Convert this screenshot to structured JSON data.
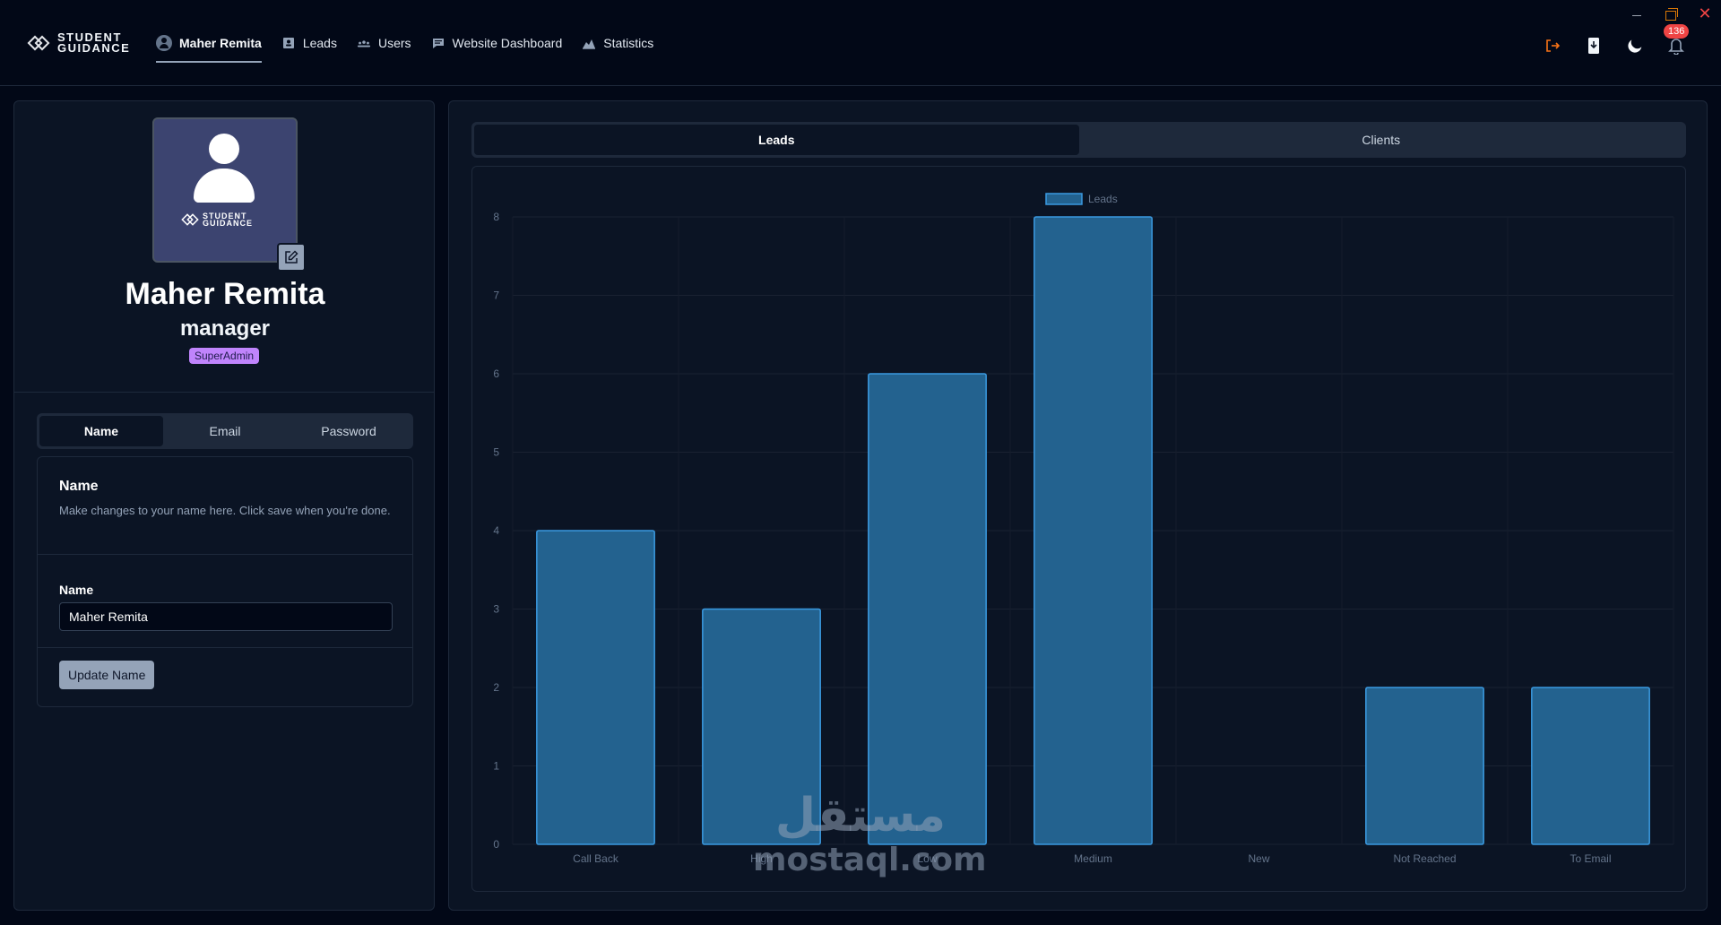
{
  "app": {
    "logo_line1": "STUDENT",
    "logo_line2": "GUIDANCE"
  },
  "nav": [
    {
      "label": "Maher Remita",
      "icon": "user-avatar-icon",
      "active": true
    },
    {
      "label": "Leads",
      "icon": "contact-book-icon",
      "active": false
    },
    {
      "label": "Users",
      "icon": "users-group-icon",
      "active": false
    },
    {
      "label": "Website Dashboard",
      "icon": "message-square-icon",
      "active": false
    },
    {
      "label": "Statistics",
      "icon": "chart-area-icon",
      "active": false
    }
  ],
  "header_actions": {
    "notifications_count": "136",
    "icons": [
      "logout-icon",
      "download-icon",
      "moon-icon",
      "bell-icon"
    ]
  },
  "profile": {
    "name": "Maher Remita",
    "role": "manager",
    "badge": "SuperAdmin"
  },
  "profile_tabs": [
    "Name",
    "Email",
    "Password"
  ],
  "name_card": {
    "title": "Name",
    "description": "Make changes to your name here. Click save when you're done.",
    "field_label": "Name",
    "field_value": "Maher Remita",
    "button_label": "Update Name"
  },
  "stats_tabs": [
    "Leads",
    "Clients"
  ],
  "chart_data": {
    "type": "bar",
    "categories": [
      "Call Back",
      "High",
      "Low",
      "Medium",
      "New",
      "Not Reached",
      "To Email"
    ],
    "series": [
      {
        "name": "Leads",
        "values": [
          4,
          3,
          6,
          8,
          0,
          2,
          2
        ]
      }
    ],
    "ylim": [
      0,
      8
    ],
    "yticks": [
      0,
      1,
      2,
      3,
      4,
      5,
      6,
      7,
      8
    ],
    "legend": "top-center",
    "grid": true,
    "bar_color": "#23628f",
    "bar_border": "#3b9ae1"
  },
  "watermark": {
    "arabic": "مستقل",
    "latin": "mostaql.com"
  },
  "colors": {
    "background": "#020817",
    "panel": "#0b1424",
    "badge": "#c084fc",
    "notification": "#ef4444"
  }
}
